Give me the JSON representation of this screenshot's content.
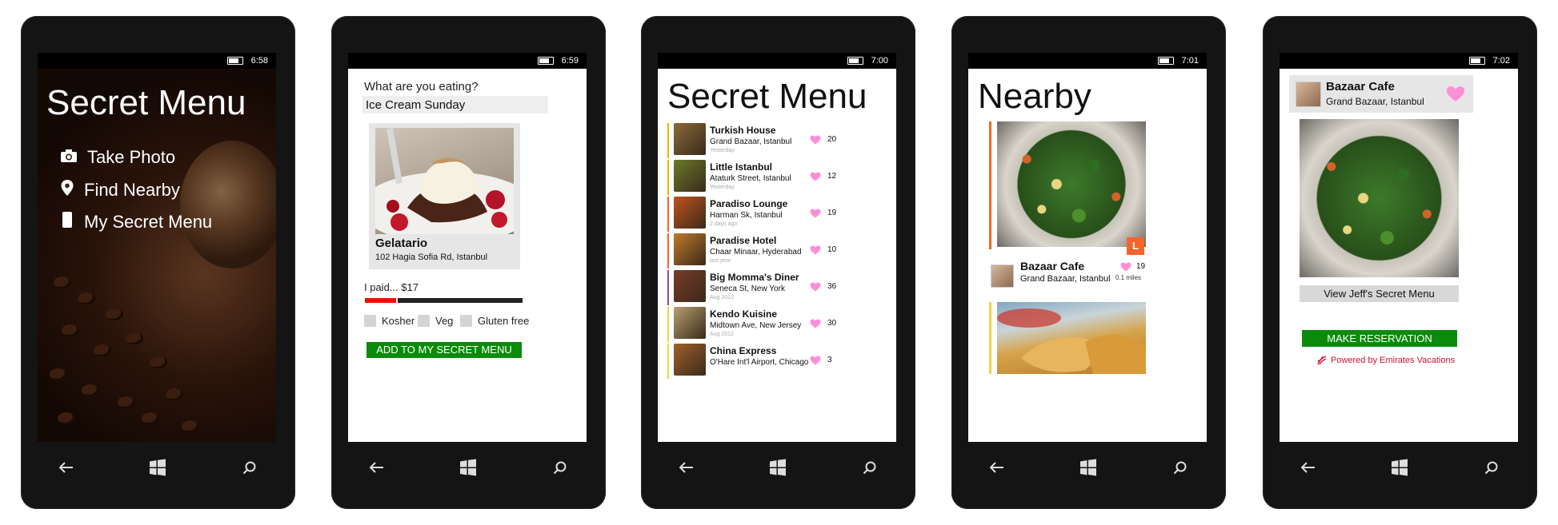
{
  "colors": {
    "accent_green": "#0b8b0b",
    "heart_pink": "#ff8fd6",
    "slider_red": "#e51400",
    "brand_red": "#d0103a"
  },
  "phone1": {
    "time": "6:58",
    "title": "Secret Menu",
    "menu": [
      {
        "label": "Take Photo",
        "icon": "camera-icon"
      },
      {
        "label": "Find Nearby",
        "icon": "map-pin-icon"
      },
      {
        "label": "My Secret Menu",
        "icon": "phone-icon"
      }
    ]
  },
  "phone2": {
    "time": "6:59",
    "question": "What are you eating?",
    "input_value": "Ice Cream Sunday",
    "place_name": "Gelatario",
    "place_address": "102 Hagia Sofia Rd, Istanbul",
    "paid_label": "I paid... $17",
    "paid_fraction": 0.2,
    "options": [
      "Kosher",
      "Veg",
      "Gluten free"
    ],
    "add_button": "ADD TO MY SECRET MENU"
  },
  "phone3": {
    "time": "7:00",
    "title": "Secret Menu",
    "items": [
      {
        "name": "Turkish House",
        "location": "Grand Bazaar, Istanbul",
        "when": "Yesterday",
        "likes": "20",
        "bar": "#f4b400",
        "thumb": "#8a6a3a"
      },
      {
        "name": "Little Istanbul",
        "location": "Ataturk Street, Istanbul",
        "when": "Yesterday",
        "likes": "12",
        "bar": "#f4b400",
        "thumb": "#6b7a2a"
      },
      {
        "name": "Paradiso Lounge",
        "location": "Harman Sk, Istanbul",
        "when": "2 days ago",
        "likes": "19",
        "bar": "#f7632a",
        "thumb": "#c0531c"
      },
      {
        "name": "Paradise Hotel",
        "location": "Chaar Minaar, Hyderabad",
        "when": "last year",
        "likes": "10",
        "bar": "#f7632a",
        "thumb": "#c07a2a"
      },
      {
        "name": "Big Momma's Diner",
        "location": "Seneca St, New York",
        "when": "Aug 2012",
        "likes": "36",
        "bar": "#8e44ad",
        "thumb": "#7a3a28"
      },
      {
        "name": "Kendo Kuisine",
        "location": "Midtown Ave, New Jersey",
        "when": "Aug 2012",
        "likes": "30",
        "bar": "#f4d03f",
        "thumb": "#b8a070"
      },
      {
        "name": "China Express",
        "location": "O'Hare Int'l Airport, Chicago",
        "when": "",
        "likes": "3",
        "bar": "#f4d03f",
        "thumb": "#a0602a"
      }
    ]
  },
  "phone4": {
    "time": "7:01",
    "title": "Nearby",
    "badge": "L",
    "place_name": "Bazaar Cafe",
    "place_location": "Grand Bazaar, Istanbul",
    "likes": "19",
    "distance": "0.1 miles"
  },
  "phone5": {
    "time": "7:02",
    "place_name": "Bazaar Cafe",
    "place_location": "Grand Bazaar, Istanbul",
    "view_button": "View Jeff's Secret Menu",
    "reserve_button": "MAKE RESERVATION",
    "powered_by": "Powered by Emirates Vacations"
  }
}
